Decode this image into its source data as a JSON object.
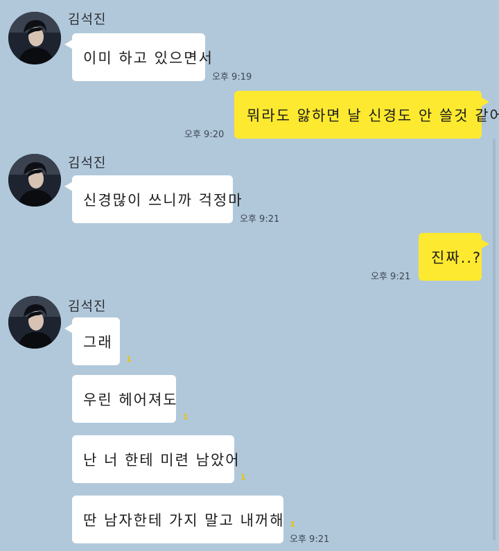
{
  "chat": {
    "colors": {
      "background": "#b1c8da",
      "incoming_bubble": "#ffffff",
      "outgoing_bubble": "#fde92f",
      "unread": "#e8c500"
    },
    "sender_name": "김석진",
    "messages": [
      {
        "id": "m1",
        "direction": "incoming",
        "text": "이미 하고 있으면서",
        "time": "오후 9:19"
      },
      {
        "id": "m2",
        "direction": "outgoing",
        "text": "뭐라도 앓하면 날 신경도 안 쓸것 같어",
        "time": "오후 9:20"
      },
      {
        "id": "m3",
        "direction": "incoming",
        "text": "신경많이 쓰니까 걱정마",
        "time": "오후 9:21"
      },
      {
        "id": "m4",
        "direction": "outgoing",
        "text": "진짜..?",
        "time": "오후 9:21"
      },
      {
        "id": "m5",
        "direction": "incoming",
        "text": "그래",
        "unread": "1"
      },
      {
        "id": "m6",
        "direction": "incoming",
        "text": "우린 헤어져도",
        "unread": "1"
      },
      {
        "id": "m7",
        "direction": "incoming",
        "text": "난 너 한테 미련 남았어",
        "unread": "1"
      },
      {
        "id": "m8",
        "direction": "incoming",
        "text": "딴 남자한테 가지 말고 내꺼해",
        "unread": "1",
        "time": "오후 9:21"
      }
    ]
  }
}
